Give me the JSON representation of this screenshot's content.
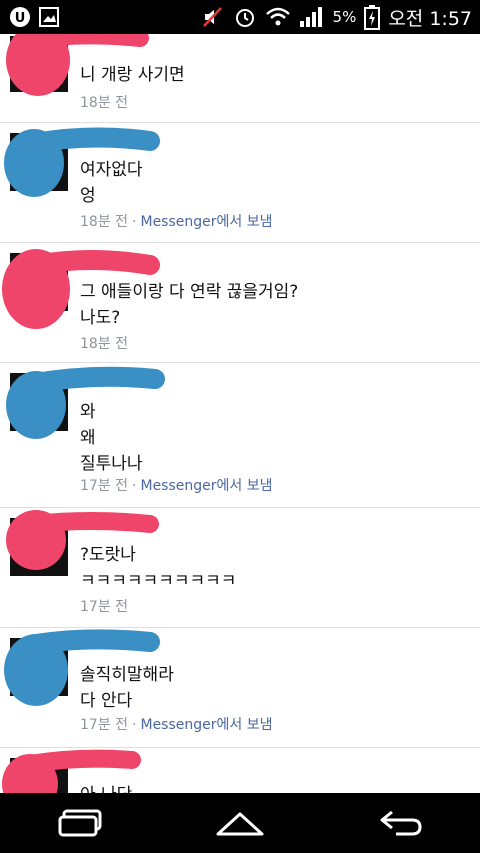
{
  "status_bar": {
    "percent": "5%",
    "time": "오전 1:57",
    "icons": [
      "u-plus-icon",
      "image-icon",
      "mute-icon",
      "alarm-icon",
      "wifi-icon",
      "signal-icon",
      "battery-icon"
    ]
  },
  "messages": [
    {
      "lines": [
        "니 개랑 사기면"
      ],
      "time": "18분 전",
      "via": "",
      "scribble_color": "#f0456a"
    },
    {
      "lines": [
        "여자없다",
        "엉"
      ],
      "time": "18분 전",
      "via": "Messenger에서 보냄",
      "scribble_color": "#3a8fc4"
    },
    {
      "lines": [
        "그 애들이랑 다 연락 끊을거임?",
        "나도?"
      ],
      "time": "18분 전",
      "via": "",
      "scribble_color": "#f0456a"
    },
    {
      "lines": [
        "와",
        "왜",
        "질투나나"
      ],
      "time": "17분 전",
      "via": "Messenger에서 보냄",
      "scribble_color": "#3a8fc4"
    },
    {
      "lines": [
        "?도랏나",
        "ㅋㅋㅋㅋㅋㅋㅋㅋㅋㅋ"
      ],
      "time": "17분 전",
      "via": "",
      "scribble_color": "#f0456a"
    },
    {
      "lines": [
        "솔직히말해라",
        "다 안다"
      ],
      "time": "17분 전",
      "via": "Messenger에서 보냄",
      "scribble_color": "#3a8fc4"
    },
    {
      "lines": [
        "아 나단"
      ],
      "time": "",
      "via": "",
      "scribble_color": "#f0456a"
    }
  ],
  "nav": {
    "icons": [
      "recent-apps-icon",
      "home-icon",
      "back-icon"
    ]
  }
}
